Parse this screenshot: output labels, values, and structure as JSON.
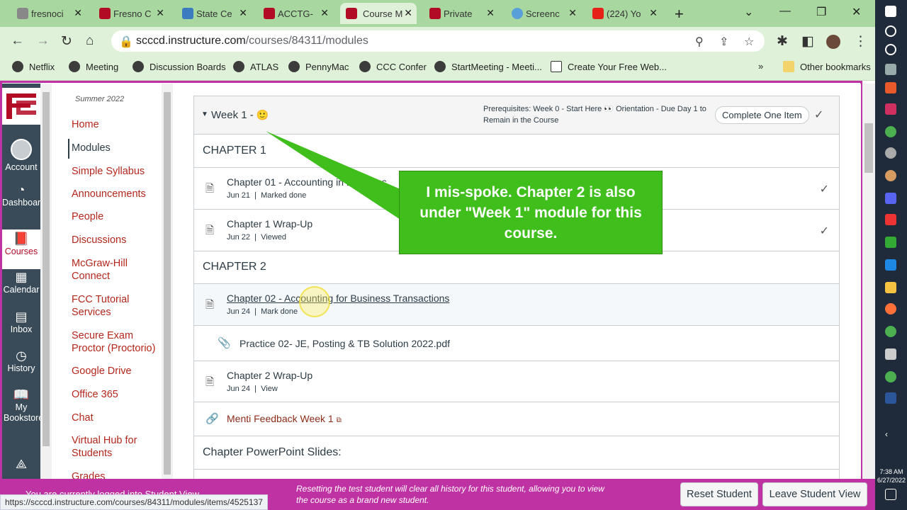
{
  "browser": {
    "tabs": [
      {
        "label": "fresnoci",
        "color": "#888888"
      },
      {
        "label": "Fresno C",
        "color": "#b20b25"
      },
      {
        "label": "State Ce",
        "color": "#3b7bbf"
      },
      {
        "label": "ACCTG-",
        "color": "#b20b25"
      },
      {
        "label": "Course M",
        "color": "#b20b25",
        "active": true
      },
      {
        "label": "Private",
        "color": "#b20b25"
      },
      {
        "label": "Screenc",
        "color": "#5aa0d8"
      },
      {
        "label": "(224) Yo",
        "color": "#e62117"
      }
    ],
    "url_host": "scccd.instructure.com",
    "url_path": "/courses/84311/modules",
    "bookmarks": [
      "Netflix",
      "Meeting",
      "Discussion Boards",
      "ATLAS",
      "PennyMac",
      "CCC Confer",
      "StartMeeting - Meeti...",
      "Create Your Free Web..."
    ],
    "other_bookmarks": "Other bookmarks"
  },
  "globalnav": {
    "account": "Account",
    "dashboard": "Dashboard",
    "courses": "Courses",
    "calendar": "Calendar",
    "inbox": "Inbox",
    "history": "History",
    "bookstore": "My Bookstore"
  },
  "coursenav": {
    "term": "Summer 2022",
    "items": [
      "Home",
      "Modules",
      "Simple Syllabus",
      "Announcements",
      "People",
      "Discussions",
      "McGraw-Hill Connect",
      "FCC Tutorial Services",
      "Secure Exam Proctor (Proctorio)",
      "Google Drive",
      "Office 365",
      "Chat",
      "Virtual Hub for Students",
      "Grades"
    ]
  },
  "module": {
    "title": "Week 1 -",
    "emoji": "🙂",
    "prereq": "Prerequisites: Week 0 - Start Here 👀 Orientation - Due Day 1 to Remain in the Course",
    "requirement": "Complete One Item",
    "chapter1": "CHAPTER 1",
    "item1_title": "Chapter 01 - Accounting in Business",
    "item1_date": "Jun 21",
    "item1_status": "Marked done",
    "item2_title": "Chapter 1 Wrap-Up",
    "item2_date": "Jun 22",
    "item2_status": "Viewed",
    "chapter2": "CHAPTER 2",
    "item3_title": "Chapter 02 - Accounting for Business Transactions",
    "item3_date": "Jun 24",
    "item3_status": "Mark done",
    "item4_title": "Practice 02- JE, Posting & TB Solution 2022.pdf",
    "item5_title": "Chapter 2 Wrap-Up",
    "item5_date": "Jun 24",
    "item5_status": "View",
    "item6_title": "Menti Feedback Week 1",
    "section3": "Chapter PowerPoint Slides:"
  },
  "callout": {
    "text": "I mis-spoke. Chapter 2 is also under \"Week 1\" module for this course."
  },
  "studentview": {
    "logged_in": "You are currently logged into Student View",
    "message": "Resetting the test student will clear all history for this student, allowing you to view the course as a brand new student.",
    "reset_label": "Reset Student",
    "leave_label": "Leave Student View"
  },
  "status_url": "https://scccd.instructure.com/courses/84311/modules/items/4525137",
  "clock": {
    "time": "7:38 AM",
    "date": "6/27/2022"
  }
}
